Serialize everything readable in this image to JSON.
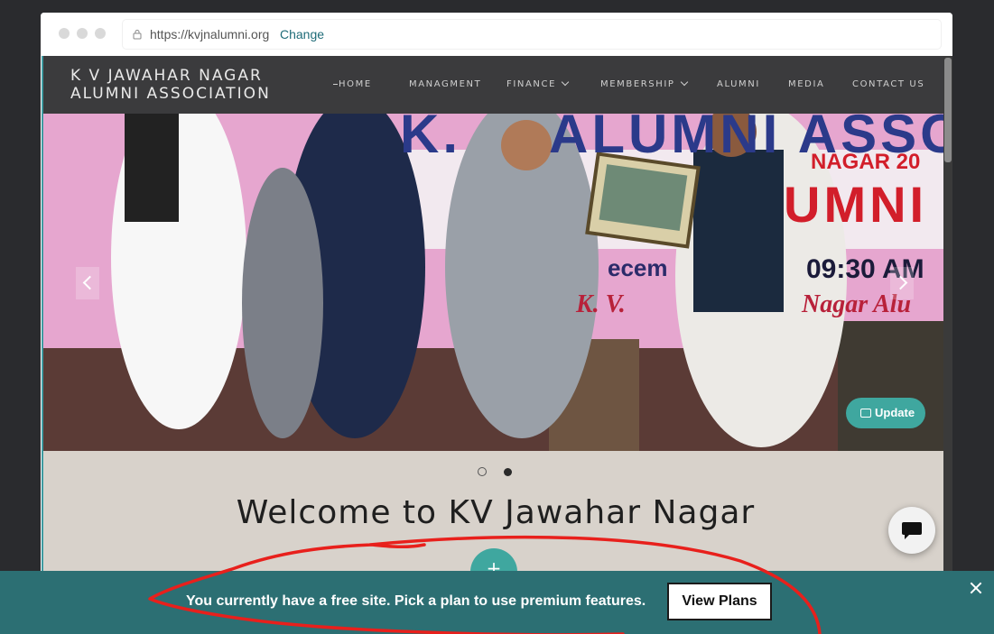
{
  "browser": {
    "url": "https://kvjnalumni.org",
    "change_label": "Change"
  },
  "site": {
    "brand_line1": "K V JAWAHAR NAGAR",
    "brand_line2": "ALUMNI ASSOCIATION",
    "nav": [
      {
        "label": "HOME",
        "dropdown": false
      },
      {
        "label": "MANAGMENT",
        "dropdown": false
      },
      {
        "label": "FINANCE",
        "dropdown": true
      },
      {
        "label": "MEMBERSHIP",
        "dropdown": true
      },
      {
        "label": "ALUMNI",
        "dropdown": false
      },
      {
        "label": "MEDIA",
        "dropdown": false
      },
      {
        "label": "CONTACT US",
        "dropdown": false
      }
    ],
    "hero": {
      "banner_fragments": [
        "K.",
        "ALUMNI ASSO",
        "NAGAR 20",
        "UMNI",
        "ecem",
        "09:30 AM",
        "K. V.",
        "Nagar Alu"
      ],
      "update_label": "Update",
      "active_slide": 2,
      "slide_count": 2
    },
    "welcome_heading": "Welcome to KV Jawahar Nagar",
    "plus_label": "+"
  },
  "promo": {
    "message": "You currently have a free site. Pick a plan to use premium features.",
    "button_label": "View Plans"
  },
  "colors": {
    "accent": "#3fa79f",
    "navbar_bg": "#3b3b3d",
    "promo_bg": "#2c6f73",
    "annotation_red": "#e8201c"
  },
  "icons": [
    "lock-icon",
    "chevron-left-icon",
    "chevron-right-icon",
    "camera-icon",
    "chat-icon",
    "close-icon",
    "chevron-down-icon"
  ]
}
